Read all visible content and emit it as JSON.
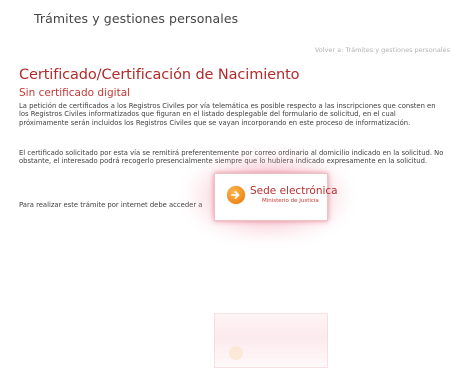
{
  "header": {
    "title": "Trámites y gestiones personales"
  },
  "back_link": {
    "prefix": "Volver a:",
    "target": "Trámites y gestiones personales"
  },
  "content": {
    "title": "Certificado/Certificación de Nacimiento",
    "subtitle": "Sin certificado digital",
    "paragraphs": [
      "La petición de certificados a los Registros Civiles por vía telemática es posible respecto a las inscripciones que consten en los Registros Civiles informatizados que figuran en el listado desplegable del formulario de solicitud, en el cual próximamente serán incluidos los Registros Civiles que se vayan incorporando en este proceso de informatización.",
      "El certificado solicitado por esta vía se remitirá preferentemente por correo ordinario al domicilio indicado en la solicitud. No obstante, el interesado podrá recogerlo presencialmente siempre que lo hubiera indicado expresamente en la solicitud.",
      "Para realizar este trámite por internet debe acceder a"
    ]
  },
  "sede_button": {
    "label": "Sede electrónica",
    "sublabel": "Ministerio de Justicia",
    "icon": "arrow-right-icon"
  },
  "colors": {
    "title_red": "#b22a2a",
    "accent_orange": "#f08a1c",
    "glow_pink": "#e75a78"
  }
}
